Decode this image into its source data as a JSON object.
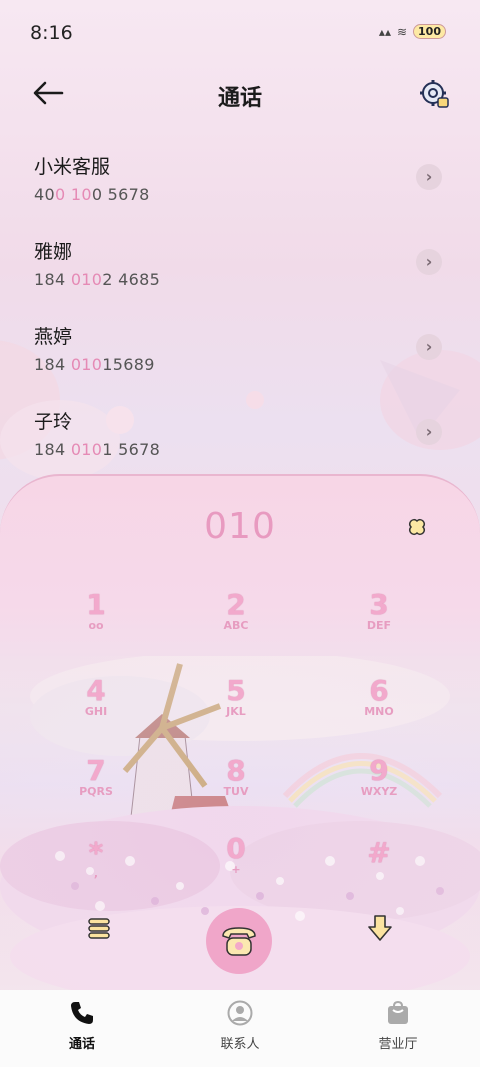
{
  "status": {
    "time": "8:16",
    "battery": "100"
  },
  "header": {
    "title": "通话"
  },
  "contacts": [
    {
      "name": "小米客服",
      "num_a": "40",
      "num_hl1": "0",
      "num_b": " ",
      "num_hl2": "10",
      "num_c": "0 5678"
    },
    {
      "name": "雅娜",
      "num_a": "184 ",
      "num_hl1": "010",
      "num_b": "2 4685",
      "num_hl2": "",
      "num_c": ""
    },
    {
      "name": "燕婷",
      "num_a": "184 ",
      "num_hl1": "010",
      "num_b": "15689",
      "num_hl2": "",
      "num_c": ""
    },
    {
      "name": "子玲",
      "num_a": "184 ",
      "num_hl1": "010",
      "num_b": "1 5678",
      "num_hl2": "",
      "num_c": ""
    }
  ],
  "dialpad": {
    "digits": "010",
    "keys": [
      {
        "num": "1",
        "letters": "oo"
      },
      {
        "num": "2",
        "letters": "ABC"
      },
      {
        "num": "3",
        "letters": "DEF"
      },
      {
        "num": "4",
        "letters": "GHI"
      },
      {
        "num": "5",
        "letters": "JKL"
      },
      {
        "num": "6",
        "letters": "MNO"
      },
      {
        "num": "7",
        "letters": "PQRS"
      },
      {
        "num": "8",
        "letters": "TUV"
      },
      {
        "num": "9",
        "letters": "WXYZ"
      },
      {
        "num": "*",
        "letters": ","
      },
      {
        "num": "0",
        "letters": "+"
      },
      {
        "num": "#",
        "letters": ""
      }
    ]
  },
  "nav": {
    "items": [
      {
        "label": "通话",
        "icon": "phone-icon"
      },
      {
        "label": "联系人",
        "icon": "person-icon"
      },
      {
        "label": "营业厅",
        "icon": "shopping-bag-icon"
      }
    ]
  },
  "colors": {
    "accent": "#e58ab5",
    "digits": "#e89ac0",
    "call_button": "#f0a6c9"
  }
}
